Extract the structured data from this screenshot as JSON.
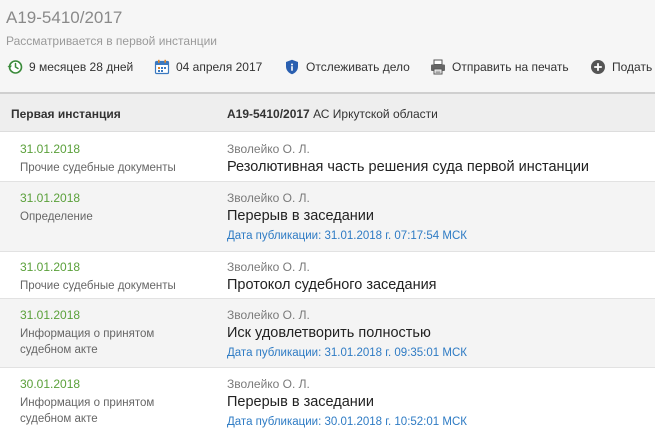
{
  "case": {
    "number": "А19-5410/2017",
    "status": "Рассматривается в первой инстанции"
  },
  "toolbar": {
    "duration_label": "9 месяцев 28 дней",
    "date_label": "04 апреля 2017",
    "track_label": "Отслеживать дело",
    "print_label": "Отправить на печать",
    "submit_label": "Подать"
  },
  "instance": {
    "title": "Первая инстанция",
    "case_number": "А19-5410/2017",
    "court": " АС Иркутской области"
  },
  "documents": [
    {
      "date": "31.01.2018",
      "type": "Прочие судебные документы",
      "judge": "Зволейко О. Л.",
      "description": "Резолютивная часть решения суда первой инстанции",
      "publication": ""
    },
    {
      "date": "31.01.2018",
      "type": "Определение",
      "judge": "Зволейко О. Л.",
      "description": "Перерыв в заседании",
      "publication": "Дата публикации: 31.01.2018 г. 07:17:54 МСК"
    },
    {
      "date": "31.01.2018",
      "type": "Прочие судебные документы",
      "judge": "Зволейко О. Л.",
      "description": "Протокол судебного заседания",
      "publication": ""
    },
    {
      "date": "31.01.2018",
      "type": "Информация о принятом судебном акте",
      "judge": "Зволейко О. Л.",
      "description": "Иск удовлетворить полностью",
      "publication": "Дата публикации: 31.01.2018 г. 09:35:01 МСК"
    },
    {
      "date": "30.01.2018",
      "type": "Информация о принятом судебном акте",
      "judge": "Зволейко О. Л.",
      "description": "Перерыв в заседании",
      "publication": "Дата публикации: 30.01.2018 г. 10:52:01 МСК"
    }
  ],
  "icons": {
    "duration": "clock-back-icon",
    "date": "calendar-icon",
    "track": "shield-icon",
    "print": "printer-icon",
    "submit": "plus-circle-icon"
  },
  "colors": {
    "date_green": "#5aa03a",
    "link_blue": "#2e7bc4",
    "header_bg": "#f6f6f6",
    "instance_bg": "#eeeeee",
    "alt_row_bg": "#f4f4f4"
  }
}
